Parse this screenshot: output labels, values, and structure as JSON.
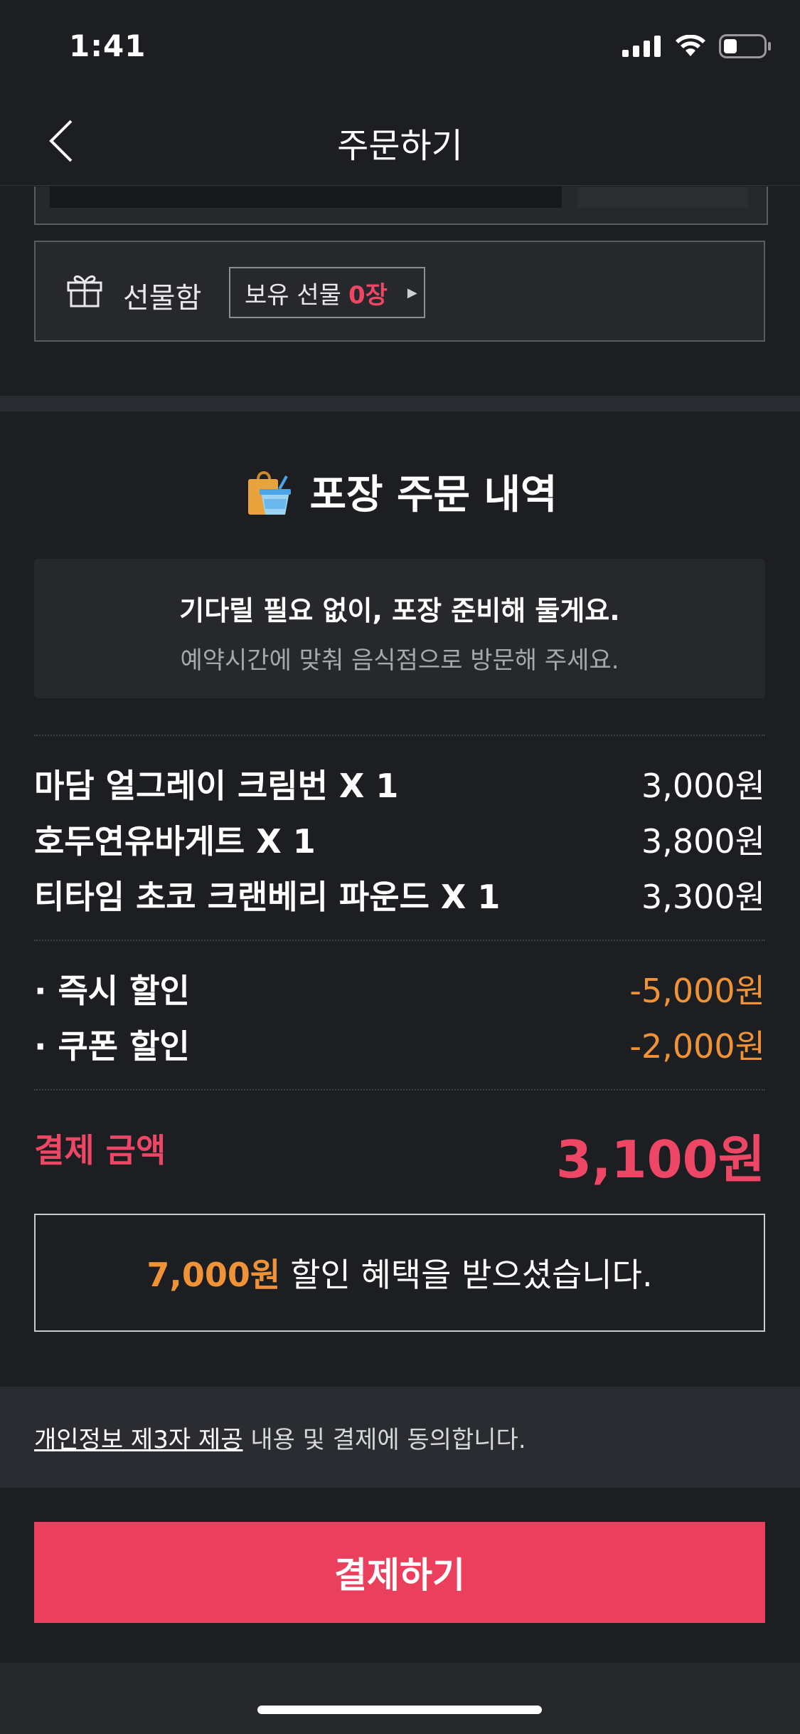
{
  "status": {
    "time": "1:41"
  },
  "nav": {
    "title": "주문하기"
  },
  "gift": {
    "label": "선물함",
    "chip_prefix": "보유 선물",
    "chip_count": "0장"
  },
  "section": {
    "title": "포장 주문 내역"
  },
  "notice": {
    "line1": "기다릴 필요 없이, 포장 준비해 둘게요.",
    "line2": "예약시간에 맞춰 음식점으로 방문해 주세요."
  },
  "items": [
    {
      "name": "마담 얼그레이 크림번 X 1",
      "price": "3,000원"
    },
    {
      "name": "호두연유바게트 X 1",
      "price": "3,800원"
    },
    {
      "name": "티타임 초코 크랜베리 파운드 X 1",
      "price": "3,300원"
    }
  ],
  "discounts": [
    {
      "name": "· 즉시 할인",
      "amount": "-5,000원"
    },
    {
      "name": "· 쿠폰 할인",
      "amount": "-2,000원"
    }
  ],
  "total": {
    "label": "결제 금액",
    "value": "3,100원"
  },
  "benefit": {
    "amount": "7,000원",
    "text": "할인 혜택을 받으셨습니다."
  },
  "agree": {
    "link": "개인정보 제3자 제공",
    "text": "내용 및 결제에 동의합니다."
  },
  "pay_button": {
    "label": "결제하기"
  },
  "colors": {
    "accent": "#ea3f5d",
    "discount": "#f09236",
    "background": "#1d1e22"
  }
}
